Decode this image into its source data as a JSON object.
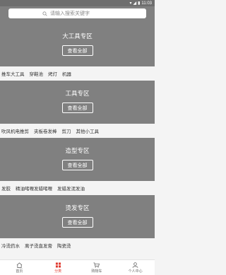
{
  "status_bar": {
    "time": "11:03"
  },
  "search": {
    "placeholder": "请输入搜索关键字"
  },
  "sections": [
    {
      "title": "大工具专区",
      "button": "查看全部",
      "tags": [
        "推车大工具",
        "穿鞋池",
        "烤灯",
        "机器"
      ]
    },
    {
      "title": "工具专区",
      "button": "查看全部",
      "tags": [
        "吹风机电推剪",
        "夹板卷发棒",
        "剪刀",
        "其他小工具"
      ]
    },
    {
      "title": "造型专区",
      "button": "查看全部",
      "tags": [
        "发胶",
        "精油啫喱发蜡啫喱",
        "发蜡发泥发油"
      ]
    },
    {
      "title": "烫发专区",
      "button": "查看全部",
      "tags": [
        "冷烫药水",
        "离子烫直发膏",
        "陶瓷烫"
      ]
    }
  ],
  "tabbar": {
    "tabs": [
      {
        "label": "首页"
      },
      {
        "label": "分类"
      },
      {
        "label": "购物车"
      },
      {
        "label": "个人中心"
      }
    ],
    "accent_color": "#e03a2f"
  }
}
